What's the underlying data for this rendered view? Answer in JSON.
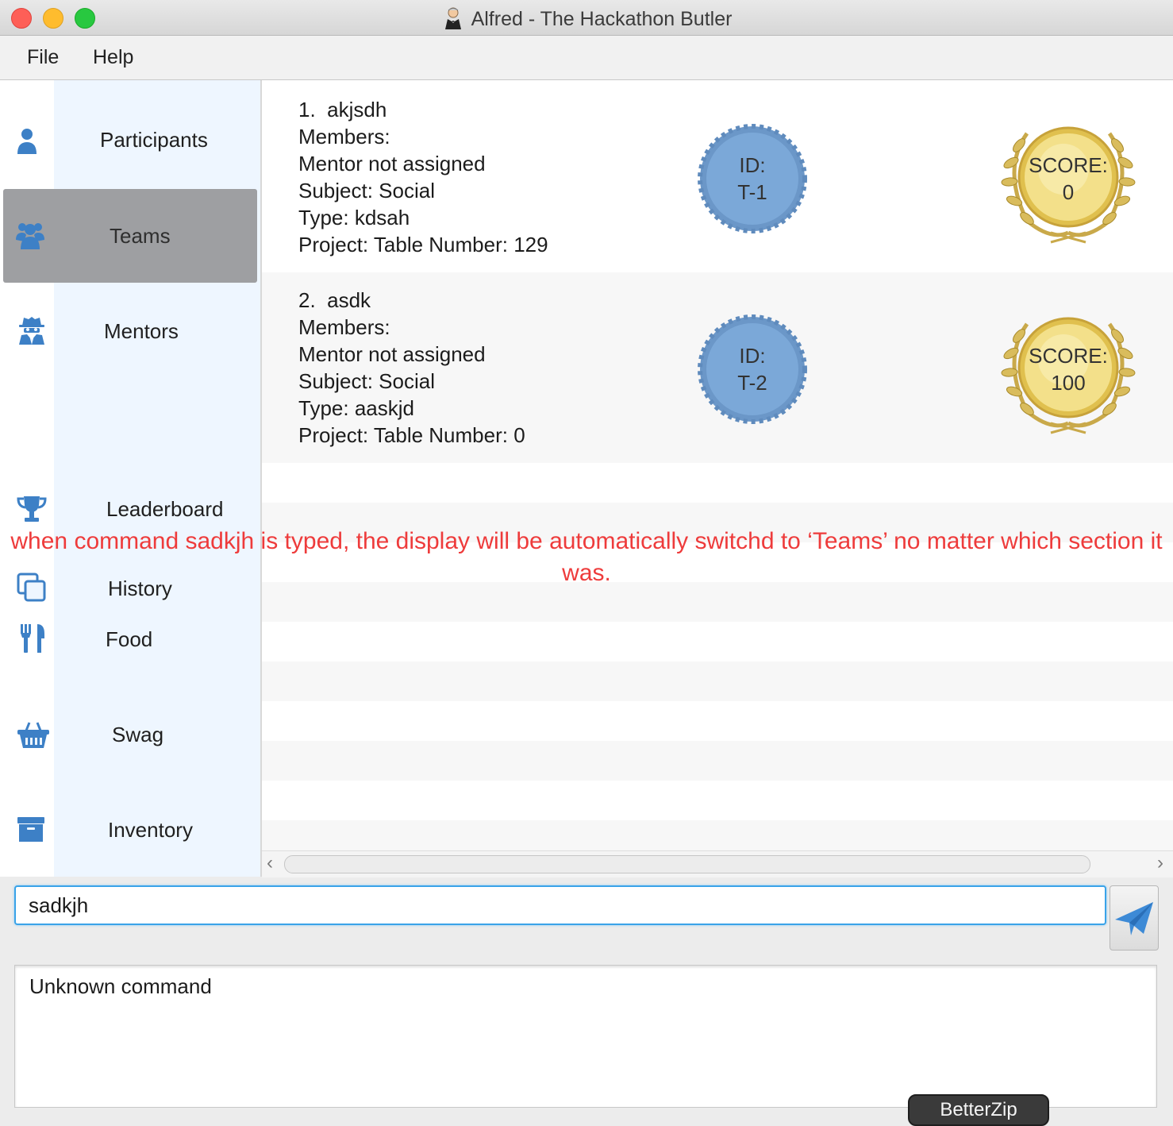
{
  "window": {
    "title": "Alfred - The Hackathon Butler",
    "traffic_light_colors": [
      "#fe5f57",
      "#febc2e",
      "#28c840"
    ]
  },
  "menu": [
    "File",
    "Help"
  ],
  "sidebar": {
    "items": [
      {
        "label": "Participants",
        "icon": "user-icon",
        "active": false
      },
      {
        "label": "Teams",
        "icon": "users-icon",
        "active": true
      },
      {
        "label": "Mentors",
        "icon": "user-secret-icon",
        "active": false
      },
      {
        "label": "Leaderboard",
        "icon": "trophy-icon",
        "active": false
      },
      {
        "label": "History",
        "icon": "copy-icon",
        "active": false
      },
      {
        "label": "Food",
        "icon": "utensils-icon",
        "active": false
      },
      {
        "label": "Swag",
        "icon": "shopping-basket-icon",
        "active": false
      },
      {
        "label": "Inventory",
        "icon": "archive-icon",
        "active": false
      }
    ],
    "icon_color": "#3d80c6",
    "active_color": "#9e9fa2"
  },
  "teams": [
    {
      "index": "1.",
      "name": "akjsdh",
      "members": "Members:",
      "mentor": "Mentor not assigned",
      "subject": "Subject: Social",
      "type": "Type: kdsah",
      "project": "Project:  Table Number: 129",
      "id_label": "ID:",
      "id_value": "T-1",
      "score_label": "SCORE:",
      "score_value": "0"
    },
    {
      "index": "2.",
      "name": "asdk",
      "members": "Members:",
      "mentor": "Mentor not assigned",
      "subject": "Subject: Social",
      "type": "Type: aaskjd",
      "project": "Project:  Table Number: 0",
      "id_label": "ID:",
      "id_value": "T-2",
      "score_label": "SCORE:",
      "score_value": "100"
    }
  ],
  "command_box": {
    "value": "sadkjh"
  },
  "result_display": {
    "text": "Unknown command"
  },
  "overlay_tab": {
    "text": "BetterZip"
  },
  "annotation": {
    "text": "when command sadkjh is typed, the display will be automatically switchd to ‘Teams’ no matter which section it was.",
    "color": "#ee3b3b"
  },
  "colors": {
    "id_badge": "#7ba8d8",
    "score_badge": "#e8cf5a",
    "input_focus": "#3aa3e8"
  }
}
